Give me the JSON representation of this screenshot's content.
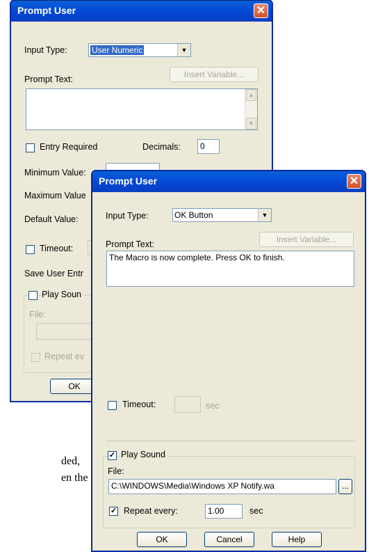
{
  "background_text": {
    "line1": "ded,",
    "line2": "en the"
  },
  "back_dialog": {
    "title": "Prompt User",
    "input_type_label": "Input Type:",
    "input_type_value": "User Numeric",
    "prompt_text_label": "Prompt Text:",
    "insert_variable_label": "Insert Variable...",
    "entry_required_label": "Entry Required",
    "decimals_label": "Decimals:",
    "decimals_value": "0",
    "minimum_value_label": "Minimum Value:",
    "maximum_value_label": "Maximum Value",
    "default_value_label": "Default Value:",
    "timeout_label": "Timeout:",
    "save_user_entry_label": "Save User Entr",
    "play_sound_label": "Play Soun",
    "file_label": "File:",
    "repeat_label": "Repeat ev",
    "ok_label": "OK"
  },
  "front_dialog": {
    "title": "Prompt User",
    "input_type_label": "Input Type:",
    "input_type_value": "OK Button",
    "prompt_text_label": "Prompt Text:",
    "insert_variable_label": "Insert Variable...",
    "prompt_text_value": "The Macro is now complete.  Press OK to finish.",
    "timeout_label": "Timeout:",
    "timeout_unit": "sec",
    "play_sound_label": "Play Sound",
    "play_sound_checked": true,
    "file_label": "File:",
    "file_value": "C:\\WINDOWS\\Media\\Windows XP Notify.wa",
    "browse_label": "...",
    "repeat_label": "Repeat every:",
    "repeat_checked": true,
    "repeat_value": "1.00",
    "repeat_unit": "sec",
    "ok_label": "OK",
    "cancel_label": "Cancel",
    "help_label": "Help"
  }
}
